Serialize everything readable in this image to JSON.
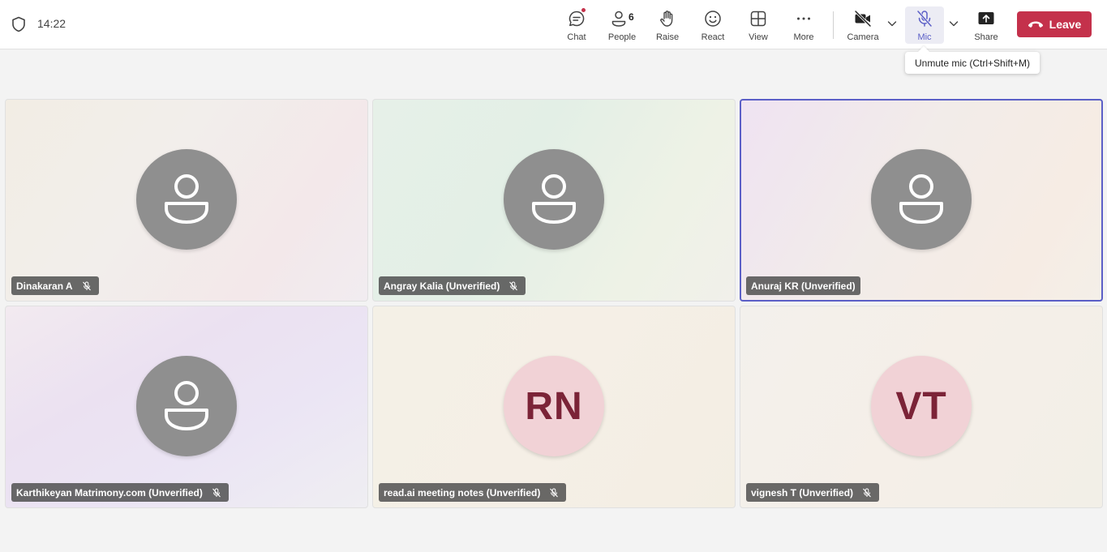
{
  "header": {
    "time": "14:22",
    "buttons": {
      "chat": "Chat",
      "people": "People",
      "people_count": "6",
      "raise": "Raise",
      "react": "React",
      "view": "View",
      "more": "More",
      "camera": "Camera",
      "mic": "Mic",
      "share": "Share",
      "leave": "Leave"
    },
    "mic_tooltip": "Unmute mic (Ctrl+Shift+M)"
  },
  "colors": {
    "accent": "#5b5fc7",
    "leave": "#c4314b",
    "notification_dot": "#c4314b",
    "avatar_generic": "#8f8f8f",
    "initials_bg": "#f1d2d6",
    "initials_text": "#7b2337"
  },
  "participants": [
    {
      "name": "Dinakaran A",
      "avatar": "person-icon",
      "muted": true
    },
    {
      "name": "Angray Kalia (Unverified)",
      "avatar": "person-icon",
      "muted": true
    },
    {
      "name": "Anuraj KR (Unverified)",
      "avatar": "person-icon",
      "muted": false,
      "highlighted": true
    },
    {
      "name": "Karthikeyan Matrimony.com (Unverified)",
      "avatar": "person-icon",
      "muted": true
    },
    {
      "name": "read.ai meeting notes (Unverified)",
      "initials": "RN",
      "muted": true
    },
    {
      "name": "vignesh T (Unverified)",
      "initials": "VT",
      "muted": true
    }
  ]
}
